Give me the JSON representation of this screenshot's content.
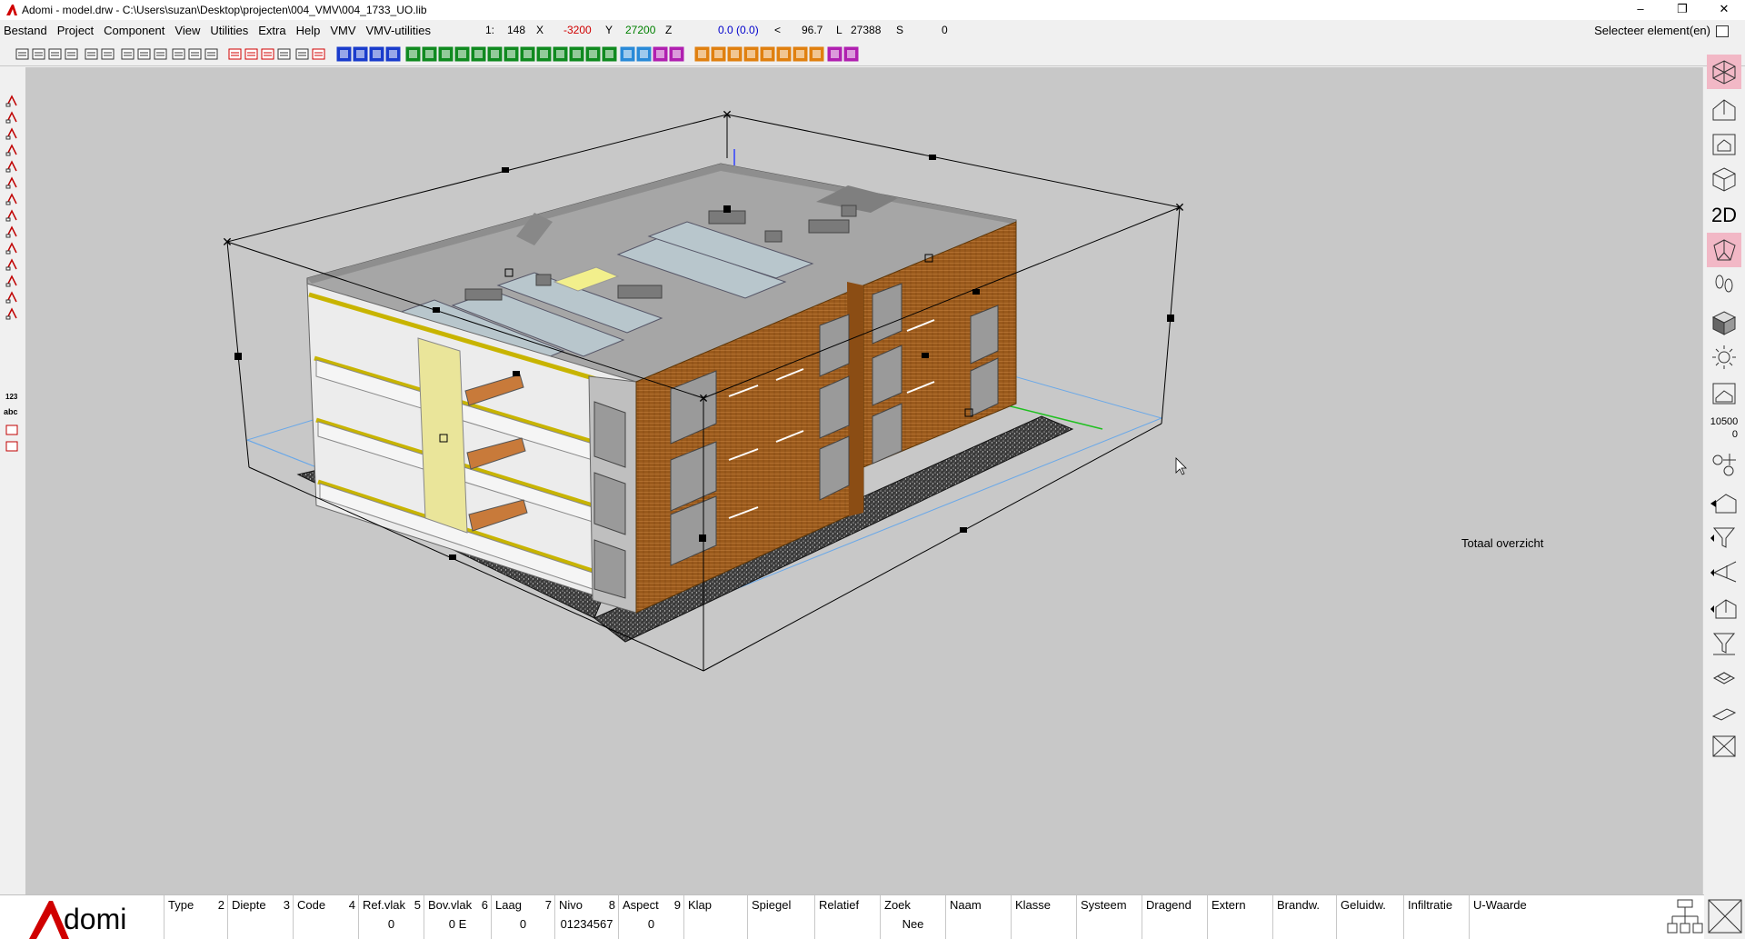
{
  "window": {
    "title": "Adomi - model.drw - C:\\Users\\suzan\\Desktop\\projecten\\004_VMV\\004_1733_UO.lib",
    "minimize": "–",
    "restore": "❐",
    "close": "✕"
  },
  "menu": [
    "Bestand",
    "Project",
    "Component",
    "View",
    "Utilities",
    "Extra",
    "Help",
    "VMV",
    "VMV-utilities"
  ],
  "coords": {
    "scale_label": "1:",
    "scale": "148",
    "x_label": "X",
    "x": "-3200",
    "y_label": "Y",
    "y": "27200",
    "z_label": "Z",
    "z": "0.0 (0.0)",
    "angle_label": "<",
    "angle": "96.7",
    "l_label": "L",
    "l": "27388",
    "s_label": "S",
    "s": "0"
  },
  "selecteer": "Selecteer element(en)",
  "viewport": {
    "label": "Totaal overzicht"
  },
  "right_tools": {
    "twod_label": "2D",
    "level_value": "10500",
    "level_sub": "0"
  },
  "left_tools": {
    "num_label": "123",
    "abc_label": "abc"
  },
  "brand": "domi",
  "statusbar": [
    {
      "label": "Type",
      "num": "2",
      "value": ""
    },
    {
      "label": "Diepte",
      "num": "3",
      "value": ""
    },
    {
      "label": "Code",
      "num": "4",
      "value": ""
    },
    {
      "label": "Ref.vlak",
      "num": "5",
      "value": "0"
    },
    {
      "label": "Bov.vlak",
      "num": "6",
      "value": "0 E"
    },
    {
      "label": "Laag",
      "num": "7",
      "value": "0"
    },
    {
      "label": "Nivo",
      "num": "8",
      "value": "01234567"
    },
    {
      "label": "Aspect",
      "num": "9",
      "value": "0"
    },
    {
      "label": "Klap",
      "num": "",
      "value": ""
    },
    {
      "label": "Spiegel",
      "num": "",
      "value": ""
    },
    {
      "label": "Relatief",
      "num": "",
      "value": ""
    },
    {
      "label": "Zoek",
      "num": "",
      "value": "Nee"
    },
    {
      "label": "Naam",
      "num": "",
      "value": ""
    },
    {
      "label": "Klasse",
      "num": "",
      "value": ""
    },
    {
      "label": "Systeem",
      "num": "",
      "value": ""
    },
    {
      "label": "Dragend",
      "num": "",
      "value": ""
    },
    {
      "label": "Extern",
      "num": "",
      "value": ""
    },
    {
      "label": "Brandw.",
      "num": "",
      "value": ""
    },
    {
      "label": "Geluidw.",
      "num": "",
      "value": ""
    },
    {
      "label": "Infiltratie",
      "num": "",
      "value": ""
    },
    {
      "label": "U-Waarde",
      "num": "",
      "value": ""
    }
  ],
  "colors": {
    "viewport_bg": "#c8c8c8",
    "brick": "#9a5a1c",
    "roof": "#a6a6a6",
    "active_tool": "#f2b8c6",
    "brand_red": "#d00000"
  }
}
